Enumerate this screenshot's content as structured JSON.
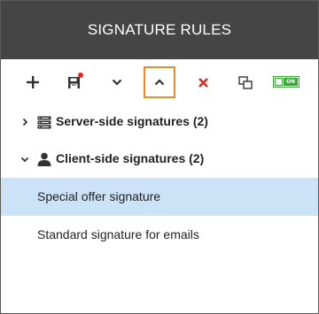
{
  "header": {
    "title": "SIGNATURE RULES"
  },
  "toolbar": {
    "toggle_label": "ON"
  },
  "groups": [
    {
      "label": "Server-side signatures (2)",
      "expanded": false,
      "icon": "server-icon"
    },
    {
      "label": "Client-side signatures (2)",
      "expanded": true,
      "icon": "user-icon"
    }
  ],
  "items": [
    {
      "label": "Special offer signature",
      "selected": true
    },
    {
      "label": "Standard signature for emails",
      "selected": false
    }
  ],
  "colors": {
    "header_bg": "#454545",
    "selection_bg": "#cce3f7",
    "accent_orange": "#f08a1c",
    "delete_red": "#e0291f",
    "toggle_green": "#3aa63a"
  }
}
